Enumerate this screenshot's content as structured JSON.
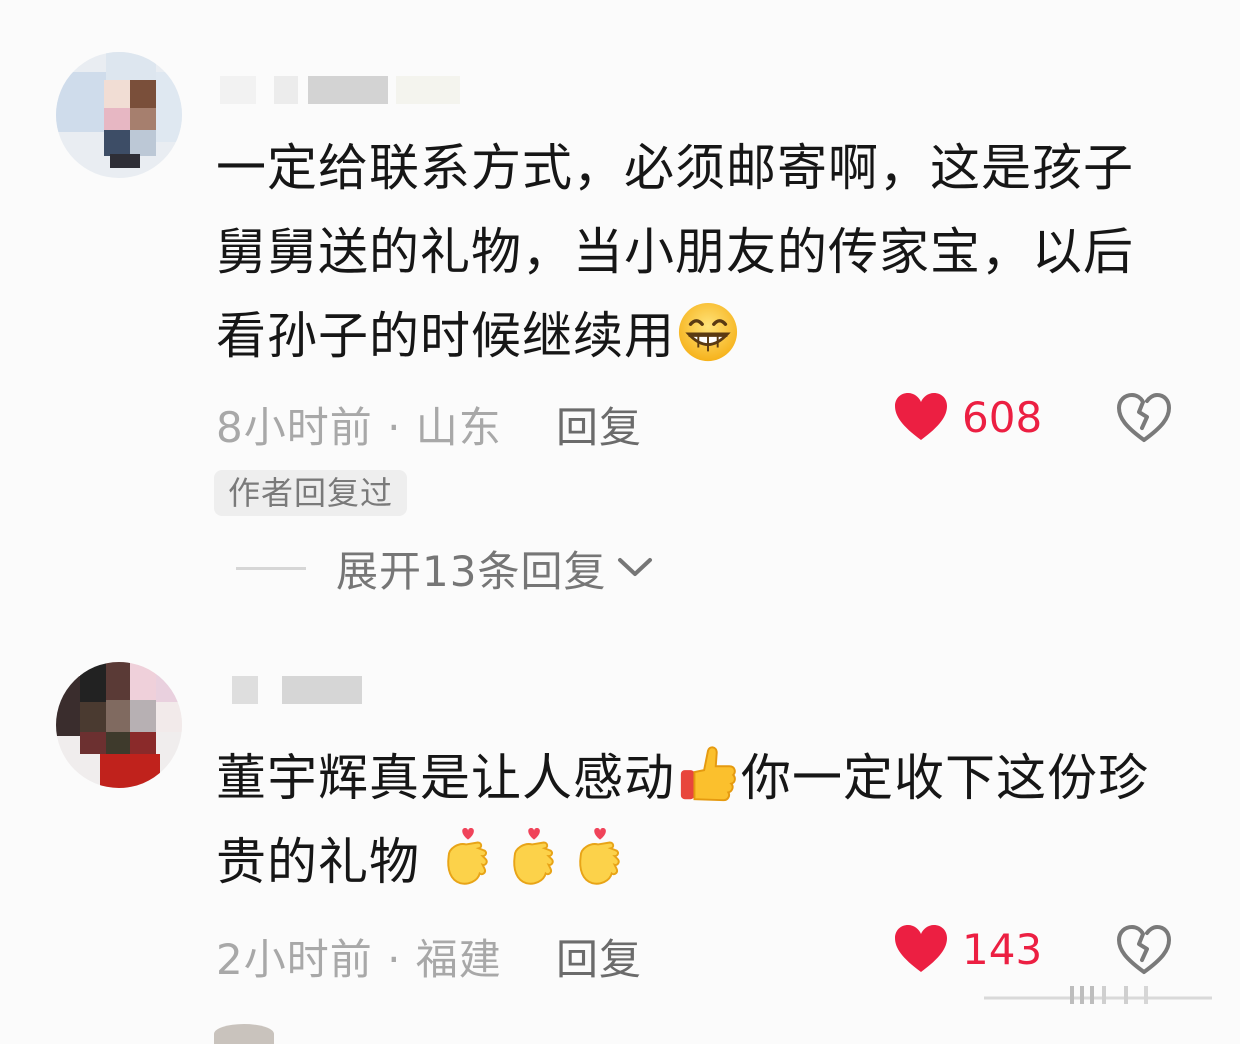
{
  "comments": [
    {
      "text_line1": "一定给联系方式，必须邮寄啊，这是孩子",
      "text_line2": "舅舅送的礼物，当小朋友的传家宝，以后",
      "text_line3": "看孙子的时候继续用",
      "emojis": [
        "grin-emoji"
      ],
      "time": "8小时前",
      "separator": " · ",
      "location": "山东",
      "reply_label": "回复",
      "likes": "608",
      "author_replied_tag": "作者回复过",
      "expand_label": "展开13条回复"
    },
    {
      "text_line1_a": "董宇辉真是让人感动",
      "text_line1_b": "你一定收下这份珍",
      "text_line2": "贵的礼物",
      "emojis": [
        "thumbs-up-emoji",
        "finger-heart-emoji",
        "finger-heart-emoji",
        "finger-heart-emoji"
      ],
      "time": "2小时前",
      "separator": " · ",
      "location": "福建",
      "reply_label": "回复",
      "likes": "143"
    }
  ],
  "colors": {
    "like_red": "#ec1f42",
    "meta_gray": "#a8a8a8",
    "background": "#fbfbfb"
  }
}
